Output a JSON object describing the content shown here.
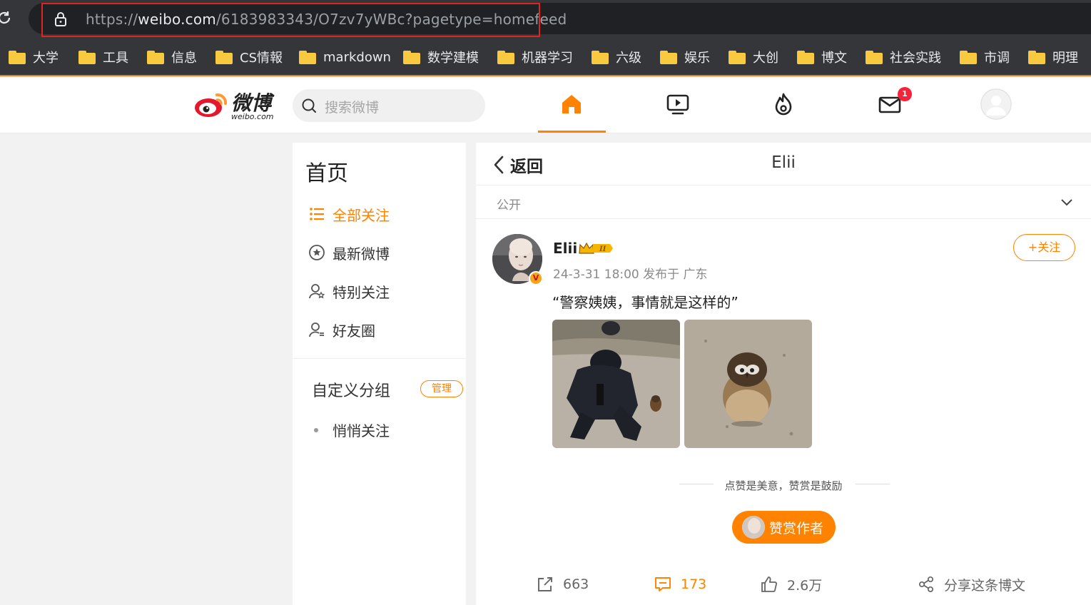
{
  "browser": {
    "url_prefix": "https://",
    "url_host": "weibo.com",
    "url_path": "/6183983343/O7zv7yWBc?pagetype=homefeed",
    "bookmarks": [
      "大学",
      "工具",
      "信息",
      "CS情報",
      "markdown",
      "数学建模",
      "机器学习",
      "六级",
      "娱乐",
      "大创",
      "博文",
      "社会实践",
      "市调",
      "明理"
    ]
  },
  "header": {
    "logo_cn": "微博",
    "logo_en": "weibo.com",
    "search_placeholder": "搜索微博",
    "message_badge": "1"
  },
  "leftnav": {
    "title": "首页",
    "items": [
      "全部关注",
      "最新微博",
      "特别关注",
      "好友圈"
    ],
    "group_title": "自定义分组",
    "manage_label": "管理",
    "sub_items": [
      "悄悄关注"
    ]
  },
  "main": {
    "back_label": "返回",
    "title": "Elii",
    "visibility": "公开",
    "post": {
      "author": "Elii",
      "meta": "24-3-31 18:00 发布于 广东",
      "follow_label": "+关注",
      "text": "“警察姨姨，事情就是这样的”",
      "verified_badge": "V"
    },
    "reward_note": "点赞是美意，赞赏是鼓励",
    "reward_button": "赞赏作者",
    "actions": {
      "repost": "663",
      "comment": "173",
      "like": "2.6万",
      "share": "分享这条博文"
    }
  },
  "colors": {
    "accent": "#ff8200",
    "chrome_bg": "#35363a",
    "highlight_box": "#e02424"
  }
}
